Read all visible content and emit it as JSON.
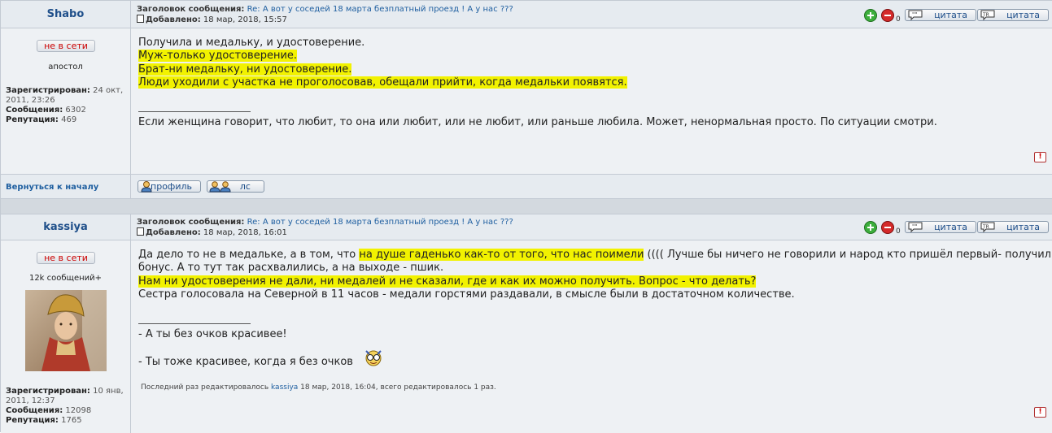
{
  "post1": {
    "author": "Shabo",
    "status": "не в сети",
    "rank": "апостол",
    "subject_label": "Заголовок сообщения:",
    "subject": "Re: А вот у соседей 18 марта безплатный проезд ! А у нас ???",
    "added_label": "Добавлено:",
    "added": "18 мар, 2018, 15:57",
    "registered_label": "Зарегистрирован:",
    "registered": "24 окт, 2011, 23:26",
    "messages_label": "Сообщения:",
    "messages": "6302",
    "reputation_label": "Репутация:",
    "reputation": "469",
    "vote_count": "0",
    "quote1": "цитата",
    "quote2": "цитата",
    "lines": [
      "Получила и медальку, и удостоверение.",
      "Муж-только удостоверение.",
      "Брат-ни медальку, ни удостоверение.",
      "Люди уходили с участка не проголосовав, обещали прийти, когда медальки появятся."
    ],
    "signature": "Если женщина говорит, что любит, то она или любит, или не любит, или раньше любила. Может, ненормальная просто. По ситуации смотри.",
    "report": "!"
  },
  "footer": {
    "back_to_top": "Вернуться к началу",
    "profile": "профиль",
    "pm": "лс"
  },
  "post2": {
    "author": "kassiya",
    "status": "не в сети",
    "rank": "12k сообщений+",
    "subject_label": "Заголовок сообщения:",
    "subject": "Re: А вот у соседей 18 марта безплатный проезд ! А у нас ???",
    "added_label": "Добавлено:",
    "added": "18 мар, 2018, 16:01",
    "registered_label": "Зарегистрирован:",
    "registered": "10 янв, 2011, 12:37",
    "messages_label": "Сообщения:",
    "messages": "12098",
    "reputation_label": "Репутация:",
    "reputation": "1765",
    "vote_count": "0",
    "quote1": "цитата",
    "quote2": "цитата",
    "line1a": "Да дело то не в медальке, а в том, что ",
    "line1b": "на душе гаденько как-то от того, что нас поимели",
    "line1c": " (((( Лучше бы ничего не говорили и народ кто пришёл первый- получил",
    "line2": "бонус. А то тут так расхвалились, а на выходе - пшик.",
    "line3": "Нам ни удостоверения не дали, ни медалей и не сказали, где и как их можно получить. Вопрос - что делать?",
    "line4": "Сестра голосовала на Северной в 11 часов - медали горстями раздавали, в смысле были в достаточном количестве.",
    "sig1": "- А ты без очков красивее!",
    "sig2": "- Ты тоже красивее, когда я без очков",
    "edit_prefix": "Последний раз редактировалось",
    "edit_user": "kassiya",
    "edit_suffix": "18 мар, 2018, 16:04, всего редактировалось 1 раз.",
    "report": "!"
  },
  "colors": {
    "highlight": "#f2f200",
    "link": "#1f5fa0",
    "offline": "#cc0000"
  }
}
